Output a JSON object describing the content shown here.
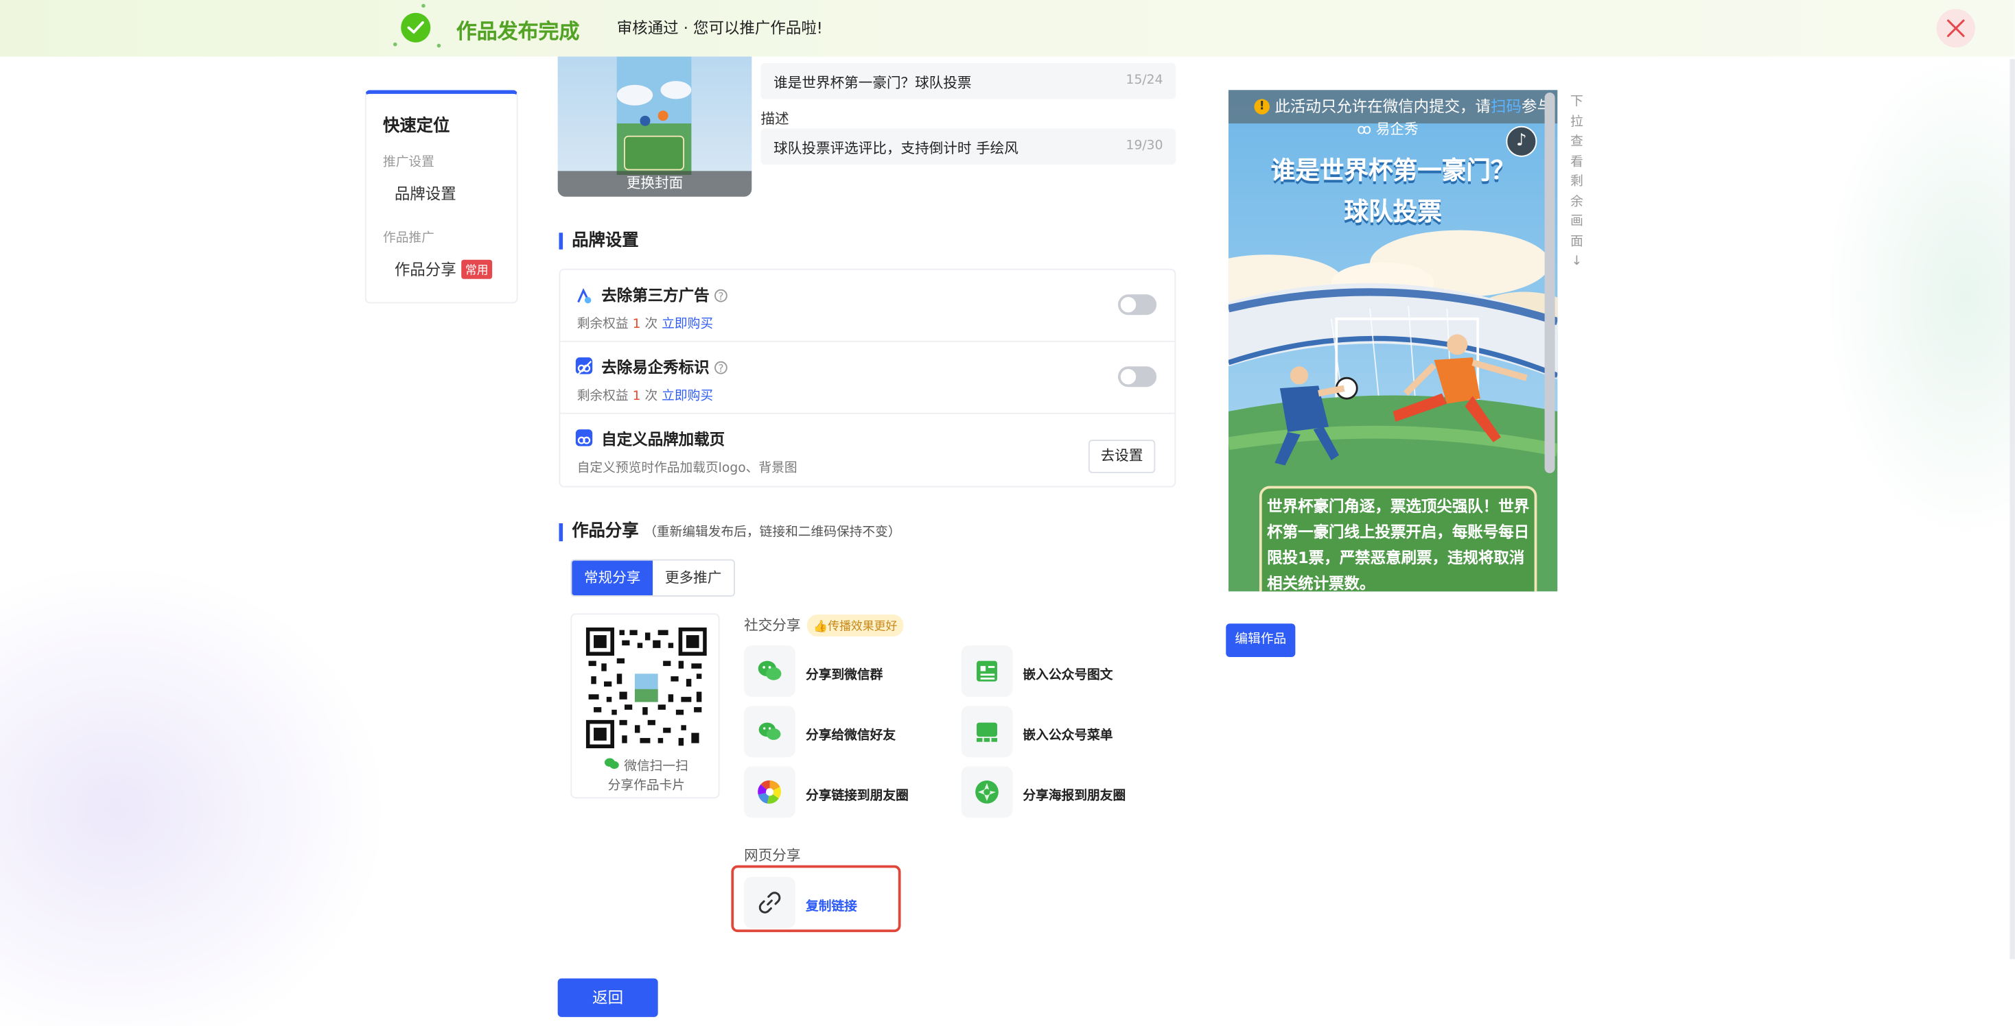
{
  "banner": {
    "title": "作品发布完成",
    "subtitle": "审核通过 · 您可以推广作品啦!"
  },
  "nav": {
    "title": "快速定位",
    "groups": [
      {
        "label": "推广设置",
        "items": [
          {
            "label": "品牌设置"
          }
        ]
      },
      {
        "label": "作品推广",
        "items": [
          {
            "label": "作品分享",
            "badge": "常用"
          }
        ]
      }
    ]
  },
  "cover": {
    "change_label": "更换封面"
  },
  "title_field": {
    "value": "谁是世界杯第一豪门？球队投票",
    "count": "15/24"
  },
  "desc_field": {
    "label": "描述",
    "value": "球队投票评选评比，支持倒计时  手绘风",
    "count": "19/30"
  },
  "brand": {
    "title": "品牌设置",
    "rows": [
      {
        "title": "去除第三方广告",
        "help": "?",
        "sub_prefix": "剩余权益",
        "count": "1",
        "sub_unit": "次",
        "link": "立即购买"
      },
      {
        "title": "去除易企秀标识",
        "help": "?",
        "sub_prefix": "剩余权益",
        "count": "1",
        "sub_unit": "次",
        "link": "立即购买"
      },
      {
        "title": "自定义品牌加载页",
        "sub": "自定义预览时作品加载页logo、背景图",
        "button": "去设置"
      }
    ]
  },
  "share": {
    "title": "作品分享",
    "note": "（重新编辑发布后，链接和二维码保持不变）",
    "tabs": [
      "常规分享",
      "更多推广"
    ],
    "qr_caption_1": "微信扫一扫",
    "qr_caption_2": "分享作品卡片",
    "social_title": "社交分享",
    "social_badge": "👍传播效果更好",
    "social_items": [
      {
        "label": "分享到微信群",
        "icon": "wechat-group-icon"
      },
      {
        "label": "嵌入公众号图文",
        "icon": "article-icon"
      },
      {
        "label": "分享给微信好友",
        "icon": "wechat-icon"
      },
      {
        "label": "嵌入公众号菜单",
        "icon": "menu-icon"
      },
      {
        "label": "分享链接到朋友圈",
        "icon": "moments-icon"
      },
      {
        "label": "分享海报到朋友圈",
        "icon": "moments-poster-icon"
      }
    ],
    "web_title": "网页分享",
    "copy_link": "复制链接"
  },
  "back_button": "返回",
  "preview": {
    "notice_prefix": "此活动只允许在微信内提交，请",
    "notice_scan": "扫码",
    "notice_suffix": "参与",
    "logo": "易企秀",
    "title_line1": "谁是世界杯第一豪门？",
    "title_line2": "球队投票",
    "description": "世界杯豪门角逐，票选顶尖强队！世界杯第一豪门线上投票开启，每账号每日限投1票，严禁恶意刷票，违规将取消相关统计票数。",
    "scroll_hint": "下拉查看剩余画面↓",
    "edit_button": "编辑作品"
  },
  "colors": {
    "primary": "#2f5cf5",
    "success": "#52c41a",
    "danger": "#e5484d"
  }
}
